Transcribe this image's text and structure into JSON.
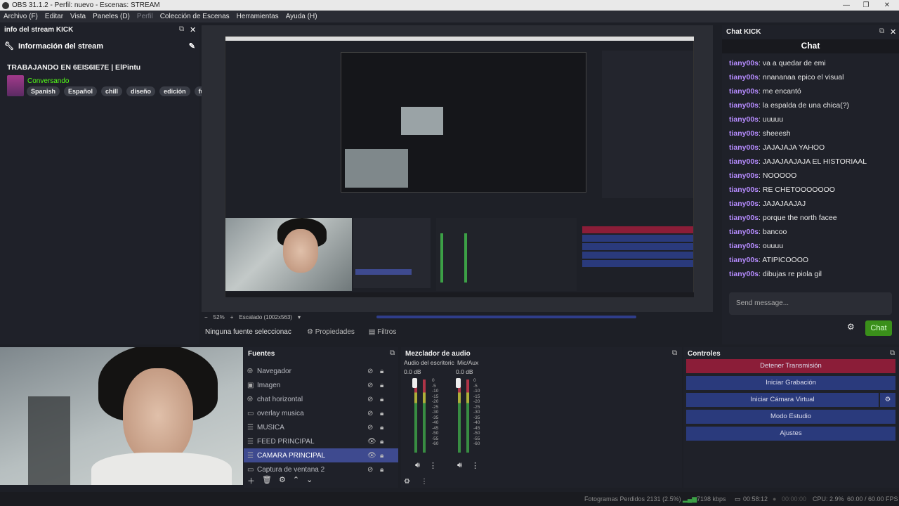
{
  "window": {
    "title": "OBS 31.1.2 - Perfil: nuevo - Escenas: STREAM"
  },
  "menu": {
    "items": [
      "Archivo (F)",
      "Editar",
      "Vista",
      "Paneles (D)",
      "Perfil",
      "Colección de Escenas",
      "Herramientas",
      "Ayuda (H)"
    ]
  },
  "info_dock": {
    "title": "info del stream KICK",
    "header": "Información del stream",
    "stream_title": "TRABAJANDO EN 6EIS6IE7E | ElPintu",
    "category": "Conversando",
    "tags": [
      "Spanish",
      "Español",
      "chill",
      "diseño",
      "edición",
      "funn"
    ]
  },
  "preview": {
    "zoom": "52%",
    "scale": "Escalado (1002x563)"
  },
  "props_bar": {
    "no_source": "Ninguna fuente seleccionac",
    "properties": "Propiedades",
    "filters": "Filtros"
  },
  "chat_dock": {
    "title": "Chat KICK",
    "header": "Chat",
    "messages": [
      {
        "user": "tiany00s",
        "text": "va a quedar de emi"
      },
      {
        "user": "tiany00s",
        "text": "nnananaa epico el visual"
      },
      {
        "user": "tiany00s",
        "text": "me encantó"
      },
      {
        "user": "tiany00s",
        "text": "la espalda de una chica(?)"
      },
      {
        "user": "tiany00s",
        "text": "uuuuu"
      },
      {
        "user": "tiany00s",
        "text": "sheeesh"
      },
      {
        "user": "tiany00s",
        "text": "JAJAJAJA YAHOO"
      },
      {
        "user": "tiany00s",
        "text": "JAJAJAAJAJA EL HISTORIAAL"
      },
      {
        "user": "tiany00s",
        "text": "NOOOOO"
      },
      {
        "user": "tiany00s",
        "text": "RE CHETOOOOOOO"
      },
      {
        "user": "tiany00s",
        "text": "JAJAJAAJAJ"
      },
      {
        "user": "tiany00s",
        "text": "porque the north facee"
      },
      {
        "user": "tiany00s",
        "text": "bancoo"
      },
      {
        "user": "tiany00s",
        "text": "ouuuu"
      },
      {
        "user": "tiany00s",
        "text": "ATIPICOOOO"
      },
      {
        "user": "tiany00s",
        "text": "dibujas re piola gil"
      }
    ],
    "placeholder": "Send message...",
    "send_label": "Chat",
    "accent": "#53fc18"
  },
  "sources": {
    "title": "Fuentes",
    "items": [
      {
        "name": "Navegador",
        "icon": "globe-icon"
      },
      {
        "name": "Imagen",
        "icon": "image-icon"
      },
      {
        "name": "chat horizontal",
        "icon": "globe-icon"
      },
      {
        "name": "overlay musica",
        "icon": "window-icon"
      },
      {
        "name": "MUSICA",
        "icon": "list-icon"
      },
      {
        "name": "FEED PRINCIPAL",
        "icon": "list-icon"
      },
      {
        "name": "CAMARA PRINCIPAL",
        "icon": "list-icon"
      },
      {
        "name": "Captura de ventana 2",
        "icon": "window-icon"
      }
    ]
  },
  "mixer": {
    "title": "Mezclador de audio",
    "channels": [
      {
        "name": "Audio del escritoric",
        "db": "0.0 dB"
      },
      {
        "name": "Mic/Aux",
        "db": "0.0 dB"
      }
    ],
    "scale": [
      "0",
      "-5",
      "-10",
      "-15",
      "-20",
      "-25",
      "-30",
      "-35",
      "-40",
      "-45",
      "-50",
      "-55",
      "-60"
    ]
  },
  "controls": {
    "title": "Controles",
    "stop_stream": "Detener Transmisión",
    "start_rec": "Iniciar Grabación",
    "virtual_cam": "Iniciar Cámara Virtual",
    "studio_mode": "Modo Estudio",
    "settings": "Ajustes"
  },
  "status": {
    "dropped": "Fotogramas Perdidos 2131 (2.5%)",
    "bitrate": "7198 kbps",
    "stream_time": "00:58:12",
    "rec_time": "00:00:00",
    "cpu": "CPU: 2.9%",
    "fps": "60.00 / 60.00 FPS"
  }
}
